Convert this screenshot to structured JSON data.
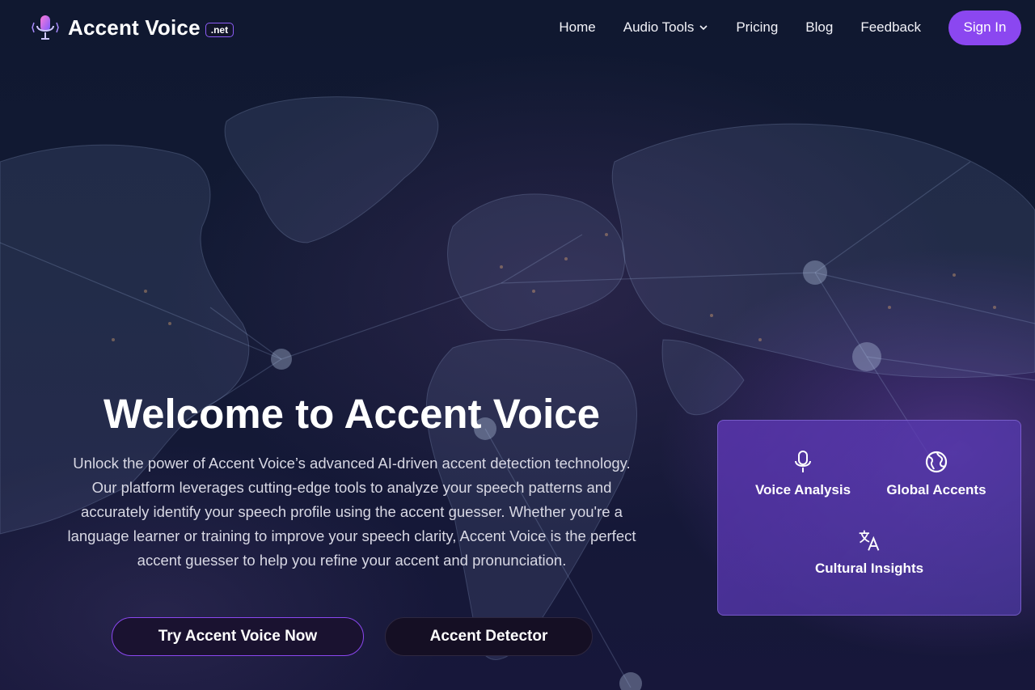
{
  "header": {
    "brand_name": "Accent Voice",
    "brand_tld": ".net",
    "nav": [
      {
        "label": "Home"
      },
      {
        "label": "Audio Tools",
        "has_dropdown": true
      },
      {
        "label": "Pricing"
      },
      {
        "label": "Blog"
      },
      {
        "label": "Feedback"
      }
    ],
    "signin_label": "Sign In"
  },
  "hero": {
    "title": "Welcome to Accent Voice",
    "description": "Unlock the power of Accent Voice’s advanced AI-driven accent detection technology. Our platform leverages cutting-edge tools to analyze your speech patterns and accurately identify your speech profile using the accent guesser. Whether you're a language learner or training to improve your speech clarity, Accent Voice is the perfect accent guesser to help you refine your accent and pronunciation.",
    "primary_button": "Try Accent Voice Now",
    "secondary_button": "Accent Detector"
  },
  "features": [
    {
      "label": "Voice Analysis",
      "icon": "microphone-icon"
    },
    {
      "label": "Global Accents",
      "icon": "globe-icon"
    },
    {
      "label": "Cultural Insights",
      "icon": "translate-icon"
    }
  ],
  "colors": {
    "accent": "#8b47f0",
    "card": "#5f37b9",
    "background": "#101830"
  }
}
